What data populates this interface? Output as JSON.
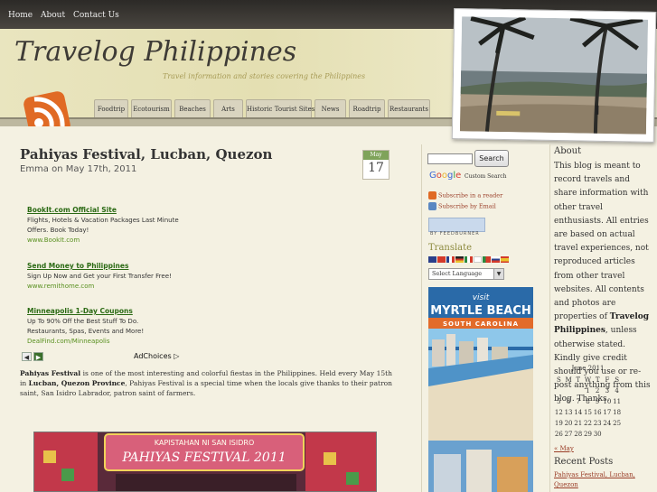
{
  "nav": {
    "items": [
      "Home",
      "About",
      "Contact Us"
    ]
  },
  "site": {
    "title": "Travelog Philippines",
    "tagline": "Travel information and stories covering the Philippines"
  },
  "categories": [
    "Foodtrip",
    "Ecotourism",
    "Beaches",
    "Arts",
    "Historic Tourist Sites",
    "News",
    "Roadtrip",
    "Restaurants"
  ],
  "post": {
    "title": "Pahiyas Festival, Lucban, Quezon",
    "meta": "Emma on May 17th, 2011",
    "date_month": "May",
    "date_day": "17",
    "body": {
      "b1": "Pahiyas Festival",
      "t1": " is one of the most interesting and colorful fiestas in the Philippines. Held every May 15th in ",
      "b2": "Lucban, Quezon Province",
      "t2": ", Pahiyas Festival is a special time when the locals give thanks to their patron saint, San Isidro Labrador, patron saint of farmers."
    },
    "image_text": {
      "line1": "KAPISTAHAN NI SAN ISIDRO",
      "line2": "PAHIYAS FESTIVAL 2011"
    }
  },
  "ads": [
    {
      "title": "BookIt.com Official Site",
      "text": "Flights, Hotels & Vacation Packages Last Minute Offers. Book Today!",
      "url": "www.BookIt.com"
    },
    {
      "title": "Send Money to Philippines",
      "text": "Sign Up Now and Get your First Transfer Free!",
      "url": "www.remithome.com"
    },
    {
      "title": "Minneapolis 1-Day Coupons",
      "text": "Up To 90% Off the Best Stuff To Do. Restaurants, Spas, Events and More!",
      "url": "DealFind.com/Minneapolis"
    }
  ],
  "adchoices": "AdChoices",
  "sidebar": {
    "search_button": "Search",
    "google_logo": "Google",
    "google_custom": "Custom Search",
    "subscribe_reader": "Subscribe in a reader",
    "subscribe_email": "Subscribe by Email",
    "feedburner": "BY FEEDBURNER",
    "translate_heading": "Translate",
    "language_select": "Select Language",
    "banner": {
      "visit": "visit",
      "name": "MYRTLE BEACH",
      "state": "SOUTH CAROLINA"
    }
  },
  "about": {
    "heading": "About",
    "text1": "This blog is meant to record travels and share information with other travel enthusiasts. All entries are based on actual travel experiences, not reproduced articles from other travel websites. All contents and photos are properties of ",
    "bold": "Travelog Philippines",
    "text2": ", unless otherwise stated. Kindly give credit should you use or re-post anything from this blog. Thanks."
  },
  "calendar": {
    "caption": "June 2011",
    "days": [
      "S",
      "M",
      "T",
      "W",
      "T",
      "F",
      "S"
    ],
    "weeks": [
      [
        "",
        "",
        "",
        "1",
        "2",
        "3",
        "4"
      ],
      [
        "5",
        "6",
        "7",
        "8",
        "9",
        "10",
        "11"
      ],
      [
        "12",
        "13",
        "14",
        "15",
        "16",
        "17",
        "18"
      ],
      [
        "19",
        "20",
        "21",
        "22",
        "23",
        "24",
        "25"
      ],
      [
        "26",
        "27",
        "28",
        "29",
        "30",
        "",
        ""
      ]
    ],
    "prev": "« May"
  },
  "recent": {
    "heading": "Recent Posts",
    "items": [
      "Pahiyas Festival, Lucban, Quezon"
    ]
  },
  "colors": {
    "accent": "#9a3d27",
    "ad_title": "#2b6a14",
    "header": "#e4dfb2"
  }
}
